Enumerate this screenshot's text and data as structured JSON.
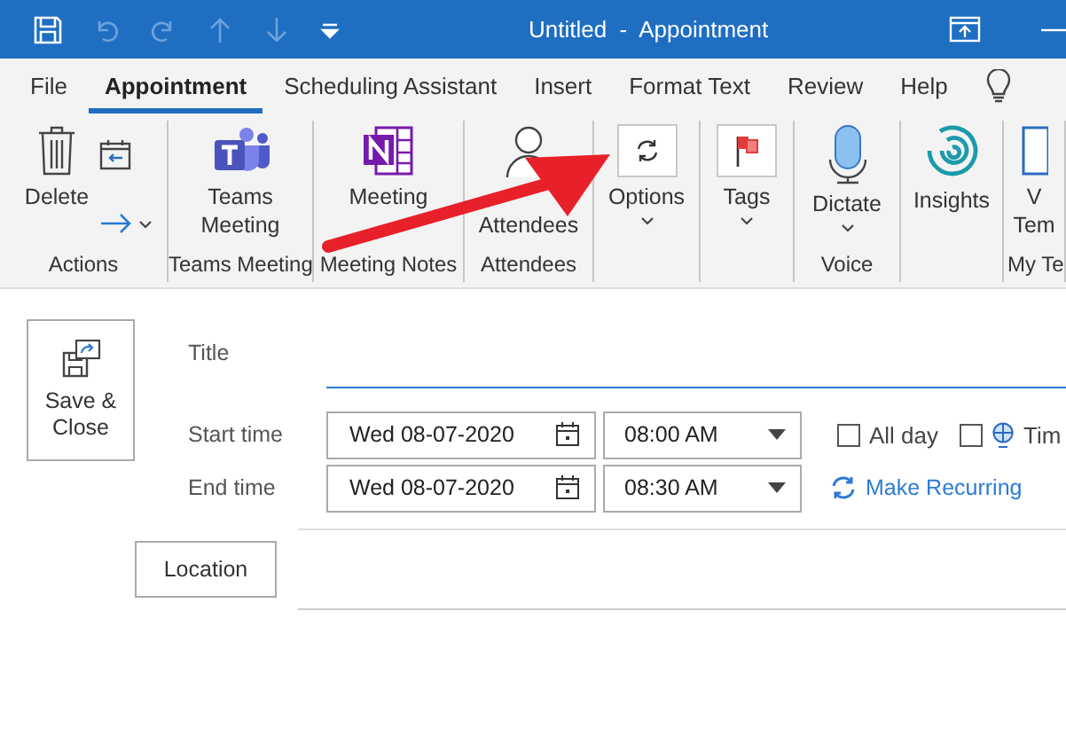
{
  "window": {
    "title": "Untitled  -  Appointment"
  },
  "tabs": [
    {
      "label": "File",
      "selected": false
    },
    {
      "label": "Appointment",
      "selected": true
    },
    {
      "label": "Scheduling Assistant",
      "selected": false
    },
    {
      "label": "Insert",
      "selected": false
    },
    {
      "label": "Format Text",
      "selected": false
    },
    {
      "label": "Review",
      "selected": false
    },
    {
      "label": "Help",
      "selected": false
    }
  ],
  "ribbon": {
    "groups": [
      {
        "label": "Actions",
        "buttons": [
          {
            "label": "Delete",
            "dropdown": false
          }
        ]
      },
      {
        "label": "Teams Meeting",
        "buttons": [
          {
            "label": "Teams Meeting",
            "dropdown": false
          }
        ]
      },
      {
        "label": "Meeting Notes",
        "buttons": [
          {
            "label": "Meeting",
            "dropdown": false
          }
        ]
      },
      {
        "label": "Attendees",
        "buttons": [
          {
            "label": "Attendees",
            "dropdown": false
          }
        ]
      },
      {
        "buttons": [
          {
            "label": "Options",
            "dropdown": true
          }
        ]
      },
      {
        "buttons": [
          {
            "label": "Tags",
            "dropdown": true
          }
        ]
      },
      {
        "label": "Voice",
        "buttons": [
          {
            "label": "Dictate",
            "dropdown": true
          }
        ]
      },
      {
        "buttons": [
          {
            "label": "Insights",
            "dropdown": false
          }
        ]
      },
      {
        "label": "My Te",
        "buttons": [
          {
            "label": "V\nTem",
            "dropdown": false
          }
        ]
      }
    ]
  },
  "form": {
    "save_close": "Save & Close",
    "title": {
      "label": "Title"
    },
    "start": {
      "label": "Start time",
      "date": "Wed 08-07-2020",
      "time": "08:00 AM"
    },
    "end": {
      "label": "End time",
      "date": "Wed 08-07-2020",
      "time": "08:30 AM"
    },
    "all_day": {
      "label": "All day",
      "checked": false
    },
    "time_zones": {
      "label": "Tim",
      "checked": false
    },
    "make_recurring": "Make Recurring",
    "location": "Location"
  }
}
